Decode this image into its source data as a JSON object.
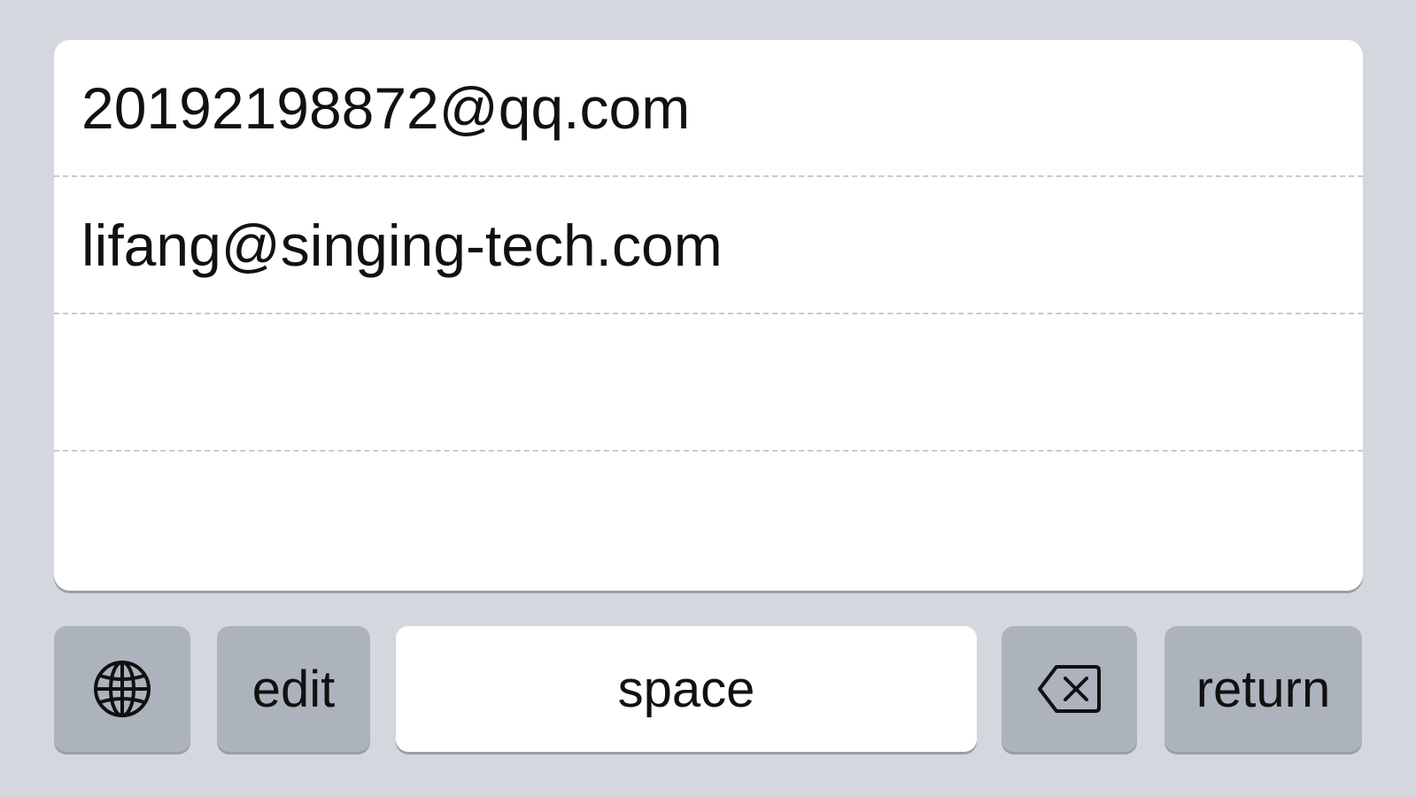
{
  "suggestions": [
    {
      "text": "20192198872@qq.com"
    },
    {
      "text": "lifang@singing-tech.com"
    },
    {
      "text": ""
    },
    {
      "text": ""
    }
  ],
  "keyboard": {
    "globe_icon": "globe-icon",
    "edit_label": "edit",
    "space_label": "space",
    "delete_icon": "backspace-icon",
    "return_label": "return"
  },
  "colors": {
    "background": "#d5d7de",
    "panel": "#ffffff",
    "function_key": "#adb3bd",
    "space_key": "#ffffff",
    "divider": "#c9cacd"
  }
}
